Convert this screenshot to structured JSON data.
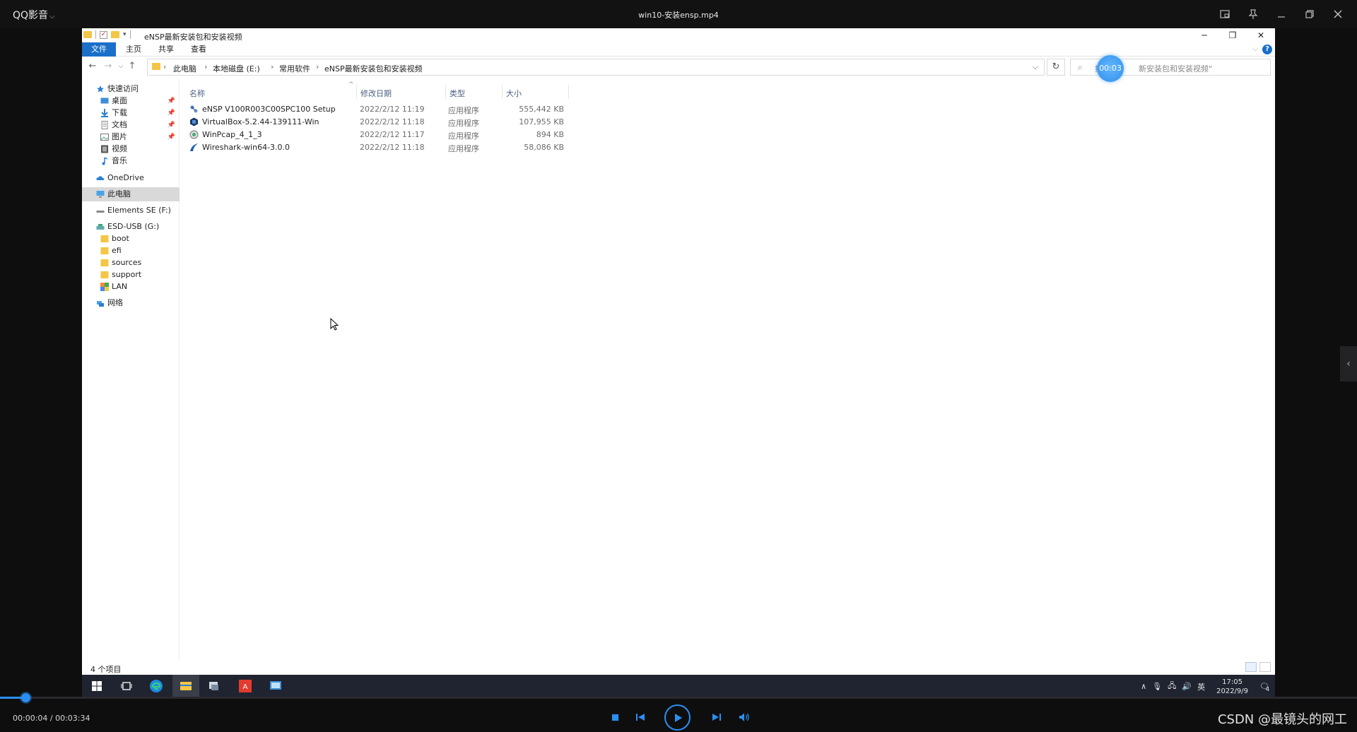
{
  "player": {
    "brand": "QQ影音",
    "file_title": "win10-安装ensp.mp4",
    "time_current": "00:00:04",
    "time_total": "00:03:34",
    "time_text": "00:00:04 / 00:03:34",
    "progress_fraction": 0.019,
    "time_bubble": "00:03",
    "watermark": "CSDN @最镜头的网工"
  },
  "explorer": {
    "title": "eNSP最新安装包和安装视频",
    "ribbon_tabs": [
      "文件",
      "主页",
      "共享",
      "查看"
    ],
    "breadcrumb": [
      "此电脑",
      "本地磁盘 (E:)",
      "常用软件",
      "eNSP最新安装包和安装视频"
    ],
    "search_placeholder": "搜索\"eNSP最新安装包和安装视频\"",
    "search_prefix": "搜索",
    "search_suffix": "新安装包和安装视频\"",
    "columns": [
      "名称",
      "修改日期",
      "类型",
      "大小"
    ],
    "files": [
      {
        "name": "eNSP V100R003C00SPC100 Setup",
        "date": "2022/2/12 11:19",
        "type": "应用程序",
        "size": "555,442 KB",
        "icon": "ensp-icon"
      },
      {
        "name": "VirtualBox-5.2.44-139111-Win",
        "date": "2022/2/12 11:18",
        "type": "应用程序",
        "size": "107,955 KB",
        "icon": "virtualbox-icon"
      },
      {
        "name": "WinPcap_4_1_3",
        "date": "2022/2/12 11:17",
        "type": "应用程序",
        "size": "894 KB",
        "icon": "winpcap-icon"
      },
      {
        "name": "Wireshark-win64-3.0.0",
        "date": "2022/2/12 11:18",
        "type": "应用程序",
        "size": "58,086 KB",
        "icon": "wireshark-icon"
      }
    ],
    "nav": {
      "quick_access": "快速访问",
      "desktop": "桌面",
      "downloads": "下载",
      "documents": "文档",
      "pictures": "图片",
      "videos": "视频",
      "music": "音乐",
      "onedrive": "OneDrive",
      "this_pc": "此电脑",
      "elements": "Elements SE (F:)",
      "esd_usb": "ESD-USB (G:)",
      "boot": "boot",
      "efi": "efi",
      "sources": "sources",
      "support": "support",
      "lan": "LAN",
      "network": "网络"
    },
    "status_count": "4 个项目"
  },
  "taskbar": {
    "ime": "英",
    "clock_time": "17:05",
    "clock_date": "2022/9/9",
    "notification_count": "4"
  },
  "colors": {
    "accent": "#2a8ff0",
    "ribbon_file": "#1a6fc9",
    "folder": "#f4c646"
  }
}
